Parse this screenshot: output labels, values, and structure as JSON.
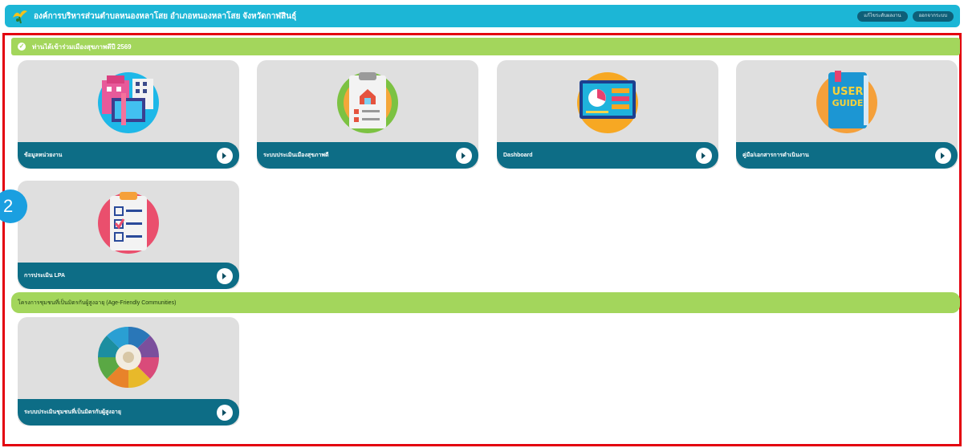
{
  "header": {
    "title": "องค์การบริหารส่วนตำบลหนองหลาโสย อำเภอหนองหลาโสย จังหวัดกาฬสินธุ์",
    "btn1": "แก้ไขระดับผลงาน",
    "btn2": "ออกจากระบบ"
  },
  "section1": {
    "title": "ท่านได้เข้าร่วมเมืองสุขภาพดีปี 2569"
  },
  "section2": {
    "title": "โครงการชุมชนที่เป็นมิตรกับผู้สูงอายุ (Age-Friendly Communities)"
  },
  "cards": [
    {
      "label": "ข้อมูลหน่วยงาน"
    },
    {
      "label": "ระบบประเมินเมืองสุขภาพดี"
    },
    {
      "label": "Dashboard"
    },
    {
      "label": "คู่มือ/เอกสารการดำเนินงาน"
    },
    {
      "label": "การประเมิน LPA"
    },
    {
      "label": "ระบบประเมินชุมชนที่เป็นมิตรกับผู้สูงอายุ"
    }
  ],
  "badge": "2",
  "colors": {
    "header": "#1cb6d6",
    "section": "#a3d65c",
    "card_footer": "#0d6d86",
    "frame": "#e3000f"
  },
  "icons": [
    "buildings-icon",
    "clipboard-house-icon",
    "dashboard-chart-icon",
    "user-guide-book-icon",
    "checklist-icon",
    "community-wheel-icon"
  ]
}
